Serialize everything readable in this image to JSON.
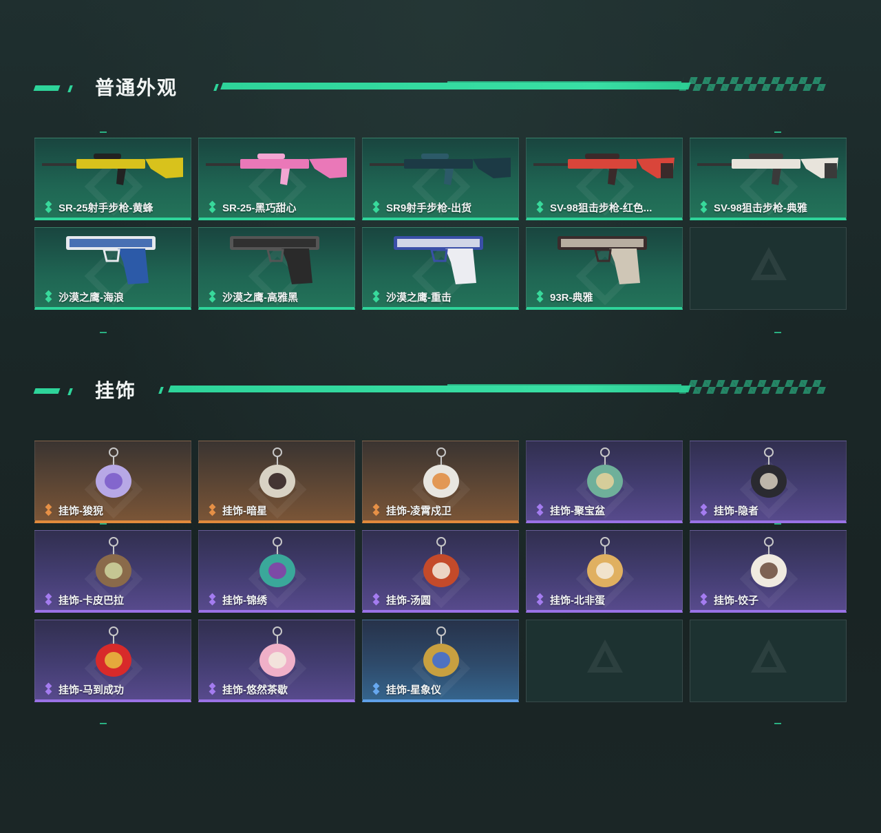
{
  "sections": {
    "skins": {
      "title": "普通外观"
    },
    "charms": {
      "title": "挂饰"
    }
  },
  "colors": {
    "accent": "#2ed49a",
    "rarity_green": "#2ed49a",
    "rarity_orange": "#e08a3c",
    "rarity_purple": "#9a72e6",
    "rarity_blue": "#5fa0e8"
  },
  "skins": [
    {
      "name": "SR-25射手步枪-黄蜂",
      "rarity": "green",
      "icon": "rifle-yellow-icon"
    },
    {
      "name": "SR-25-黑巧甜心",
      "rarity": "green",
      "icon": "rifle-pink-icon"
    },
    {
      "name": "SR9射手步枪-出货",
      "rarity": "green",
      "icon": "rifle-teal-icon"
    },
    {
      "name": "SV-98狙击步枪-红色...",
      "rarity": "green",
      "icon": "sniper-red-icon"
    },
    {
      "name": "SV-98狙击步枪-典雅",
      "rarity": "green",
      "icon": "sniper-white-icon"
    },
    {
      "name": "沙漠之鹰-海浪",
      "rarity": "green",
      "icon": "pistol-blue-icon"
    },
    {
      "name": "沙漠之鹰-高雅黑",
      "rarity": "green",
      "icon": "pistol-black-icon"
    },
    {
      "name": "沙漠之鹰-重击",
      "rarity": "green",
      "icon": "pistol-white-icon"
    },
    {
      "name": "93R-典雅",
      "rarity": "green",
      "icon": "pistol-beige-icon"
    },
    {
      "name": "",
      "rarity": "empty",
      "icon": "placeholder-logo-icon"
    }
  ],
  "charms": [
    {
      "name": "挂饰-狻猊",
      "rarity": "orange",
      "icon": "lion-charm-icon"
    },
    {
      "name": "挂饰-暗星",
      "rarity": "orange",
      "icon": "bird-charm-icon"
    },
    {
      "name": "挂饰-凌霄戍卫",
      "rarity": "orange",
      "icon": "guard-charm-icon"
    },
    {
      "name": "挂饰-聚宝盆",
      "rarity": "purple",
      "icon": "treasure-bowl-charm-icon"
    },
    {
      "name": "挂饰-隐者",
      "rarity": "purple",
      "icon": "tarot-card-charm-icon"
    },
    {
      "name": "挂饰-卡皮巴拉",
      "rarity": "purple",
      "icon": "capybara-charm-icon"
    },
    {
      "name": "挂饰-锦绣",
      "rarity": "purple",
      "icon": "butterfly-charm-icon"
    },
    {
      "name": "挂饰-汤圆",
      "rarity": "purple",
      "icon": "tangyuan-charm-icon"
    },
    {
      "name": "挂饰-北非蛋",
      "rarity": "purple",
      "icon": "shakshuka-charm-icon"
    },
    {
      "name": "挂饰-饺子",
      "rarity": "purple",
      "icon": "dumpling-charm-icon"
    },
    {
      "name": "挂饰-马到成功",
      "rarity": "purple",
      "icon": "horse-charm-icon"
    },
    {
      "name": "挂饰-悠然茶歇",
      "rarity": "purple",
      "icon": "cupcake-charm-icon"
    },
    {
      "name": "挂饰-星象仪",
      "rarity": "blue",
      "icon": "astrolabe-charm-icon"
    },
    {
      "name": "",
      "rarity": "empty",
      "icon": "placeholder-logo-icon"
    },
    {
      "name": "",
      "rarity": "empty",
      "icon": "placeholder-logo-icon"
    }
  ]
}
